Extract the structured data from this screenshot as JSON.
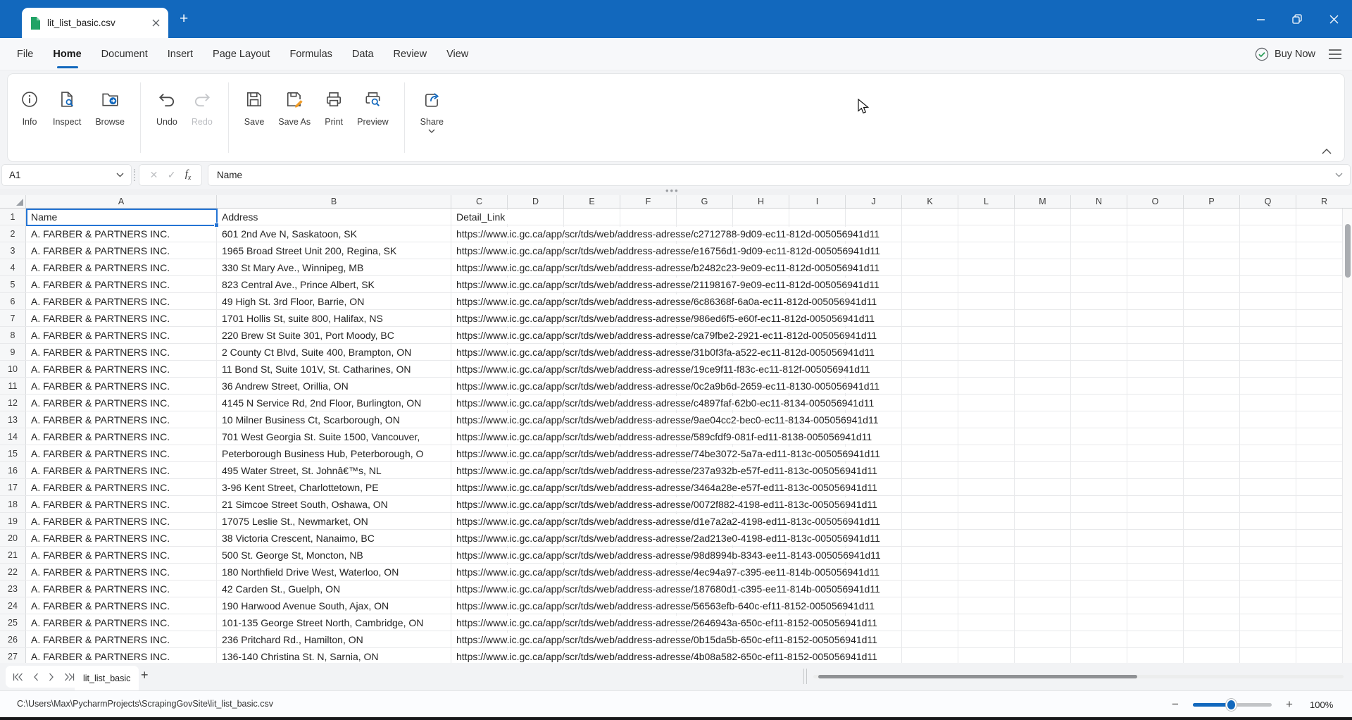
{
  "window": {
    "tab_title": "lit_list_basic.csv",
    "buy_now_label": "Buy Now"
  },
  "menu": {
    "items": [
      "File",
      "Home",
      "Document",
      "Insert",
      "Page Layout",
      "Formulas",
      "Data",
      "Review",
      "View"
    ],
    "active": "Home"
  },
  "toolbar": {
    "info": "Info",
    "inspect": "Inspect",
    "browse": "Browse",
    "undo": "Undo",
    "redo": "Redo",
    "save": "Save",
    "save_as": "Save As",
    "print": "Print",
    "preview": "Preview",
    "share": "Share"
  },
  "formula_bar": {
    "cell_ref": "A1",
    "content": "Name"
  },
  "grid": {
    "columns": [
      "A",
      "B",
      "C",
      "D",
      "E",
      "F",
      "G",
      "H",
      "I",
      "J",
      "K",
      "L",
      "M",
      "N",
      "O",
      "P",
      "Q",
      "R"
    ],
    "selected_cell": "A1",
    "rows": [
      [
        "Name",
        "Address",
        "Detail_Link"
      ],
      [
        "A. FARBER & PARTNERS INC.",
        "601 2nd Ave N, Saskatoon, SK",
        "https://www.ic.gc.ca/app/scr/tds/web/address-adresse/c2712788-9d09-ec11-812d-005056941d11"
      ],
      [
        "A. FARBER & PARTNERS INC.",
        "1965 Broad Street Unit 200, Regina, SK",
        "https://www.ic.gc.ca/app/scr/tds/web/address-adresse/e16756d1-9d09-ec11-812d-005056941d11"
      ],
      [
        "A. FARBER & PARTNERS INC.",
        "330 St Mary Ave., Winnipeg, MB",
        "https://www.ic.gc.ca/app/scr/tds/web/address-adresse/b2482c23-9e09-ec11-812d-005056941d11"
      ],
      [
        "A. FARBER & PARTNERS INC.",
        "823 Central Ave., Prince Albert, SK",
        "https://www.ic.gc.ca/app/scr/tds/web/address-adresse/21198167-9e09-ec11-812d-005056941d11"
      ],
      [
        "A. FARBER & PARTNERS INC.",
        "49 High St. 3rd Floor, Barrie, ON",
        "https://www.ic.gc.ca/app/scr/tds/web/address-adresse/6c86368f-6a0a-ec11-812d-005056941d11"
      ],
      [
        "A. FARBER & PARTNERS INC.",
        "1701 Hollis St, suite 800, Halifax, NS",
        "https://www.ic.gc.ca/app/scr/tds/web/address-adresse/986ed6f5-e60f-ec11-812d-005056941d11"
      ],
      [
        "A. FARBER & PARTNERS INC.",
        "220 Brew St Suite 301, Port Moody, BC",
        "https://www.ic.gc.ca/app/scr/tds/web/address-adresse/ca79fbe2-2921-ec11-812d-005056941d11"
      ],
      [
        "A. FARBER & PARTNERS INC.",
        "2 County Ct Blvd, Suite 400, Brampton, ON",
        "https://www.ic.gc.ca/app/scr/tds/web/address-adresse/31b0f3fa-a522-ec11-812d-005056941d11"
      ],
      [
        "A. FARBER & PARTNERS INC.",
        "11 Bond St, Suite 101V, St. Catharines, ON",
        "https://www.ic.gc.ca/app/scr/tds/web/address-adresse/19ce9f11-f83c-ec11-812f-005056941d11"
      ],
      [
        "A. FARBER & PARTNERS INC.",
        "36 Andrew Street, Orillia, ON",
        "https://www.ic.gc.ca/app/scr/tds/web/address-adresse/0c2a9b6d-2659-ec11-8130-005056941d11"
      ],
      [
        "A. FARBER & PARTNERS INC.",
        "4145 N Service Rd, 2nd Floor, Burlington, ON",
        "https://www.ic.gc.ca/app/scr/tds/web/address-adresse/c4897faf-62b0-ec11-8134-005056941d11"
      ],
      [
        "A. FARBER & PARTNERS INC.",
        "10 Milner Business Ct, Scarborough, ON",
        "https://www.ic.gc.ca/app/scr/tds/web/address-adresse/9ae04cc2-bec0-ec11-8134-005056941d11"
      ],
      [
        "A. FARBER & PARTNERS INC.",
        "701 West Georgia St. Suite 1500, Vancouver,",
        "https://www.ic.gc.ca/app/scr/tds/web/address-adresse/589cfdf9-081f-ed11-8138-005056941d11"
      ],
      [
        "A. FARBER & PARTNERS INC.",
        "Peterborough Business Hub, Peterborough, O",
        "https://www.ic.gc.ca/app/scr/tds/web/address-adresse/74be3072-5a7a-ed11-813c-005056941d11"
      ],
      [
        "A. FARBER & PARTNERS INC.",
        "495 Water Street, St. Johnâ€™s, NL",
        "https://www.ic.gc.ca/app/scr/tds/web/address-adresse/237a932b-e57f-ed11-813c-005056941d11"
      ],
      [
        "A. FARBER & PARTNERS INC.",
        "3-96 Kent Street, Charlottetown, PE",
        "https://www.ic.gc.ca/app/scr/tds/web/address-adresse/3464a28e-e57f-ed11-813c-005056941d11"
      ],
      [
        "A. FARBER & PARTNERS INC.",
        "21 Simcoe Street South, Oshawa, ON",
        "https://www.ic.gc.ca/app/scr/tds/web/address-adresse/0072f882-4198-ed11-813c-005056941d11"
      ],
      [
        "A. FARBER & PARTNERS INC.",
        "17075 Leslie St., Newmarket, ON",
        "https://www.ic.gc.ca/app/scr/tds/web/address-adresse/d1e7a2a2-4198-ed11-813c-005056941d11"
      ],
      [
        "A. FARBER & PARTNERS INC.",
        "38 Victoria Crescent, Nanaimo, BC",
        "https://www.ic.gc.ca/app/scr/tds/web/address-adresse/2ad213e0-4198-ed11-813c-005056941d11"
      ],
      [
        "A. FARBER & PARTNERS INC.",
        "500 St. George St, Moncton, NB",
        "https://www.ic.gc.ca/app/scr/tds/web/address-adresse/98d8994b-8343-ee11-8143-005056941d11"
      ],
      [
        "A. FARBER & PARTNERS INC.",
        "180 Northfield Drive West, Waterloo, ON",
        "https://www.ic.gc.ca/app/scr/tds/web/address-adresse/4ec94a97-c395-ee11-814b-005056941d11"
      ],
      [
        "A. FARBER & PARTNERS INC.",
        "42 Carden St., Guelph, ON",
        "https://www.ic.gc.ca/app/scr/tds/web/address-adresse/187680d1-c395-ee11-814b-005056941d11"
      ],
      [
        "A. FARBER & PARTNERS INC.",
        "190 Harwood Avenue South, Ajax, ON",
        "https://www.ic.gc.ca/app/scr/tds/web/address-adresse/56563efb-640c-ef11-8152-005056941d11"
      ],
      [
        "A. FARBER & PARTNERS INC.",
        "101-135 George Street North, Cambridge, ON",
        "https://www.ic.gc.ca/app/scr/tds/web/address-adresse/2646943a-650c-ef11-8152-005056941d11"
      ],
      [
        "A. FARBER & PARTNERS INC.",
        "236 Pritchard Rd., Hamilton, ON",
        "https://www.ic.gc.ca/app/scr/tds/web/address-adresse/0b15da5b-650c-ef11-8152-005056941d11"
      ],
      [
        "A. FARBER & PARTNERS INC.",
        "136-140 Christina St. N, Sarnia, ON",
        "https://www.ic.gc.ca/app/scr/tds/web/address-adresse/4b08a582-650c-ef11-8152-005056941d11"
      ]
    ]
  },
  "sheet_bar": {
    "active_tab": "lit_list_basic"
  },
  "status_bar": {
    "file_path": "C:\\Users\\Max\\PycharmProjects\\ScrapingGovSite\\lit_list_basic.csv",
    "zoom_level": "100%"
  },
  "colors": {
    "titlebar_blue": "#1268bd",
    "accent_blue": "#1268bd",
    "selection_blue": "#2474d4",
    "doc_icon_green": "#21a366",
    "buynow_check_green": "#2e9e5b",
    "saveas_pencil_orange": "#f09c28"
  }
}
